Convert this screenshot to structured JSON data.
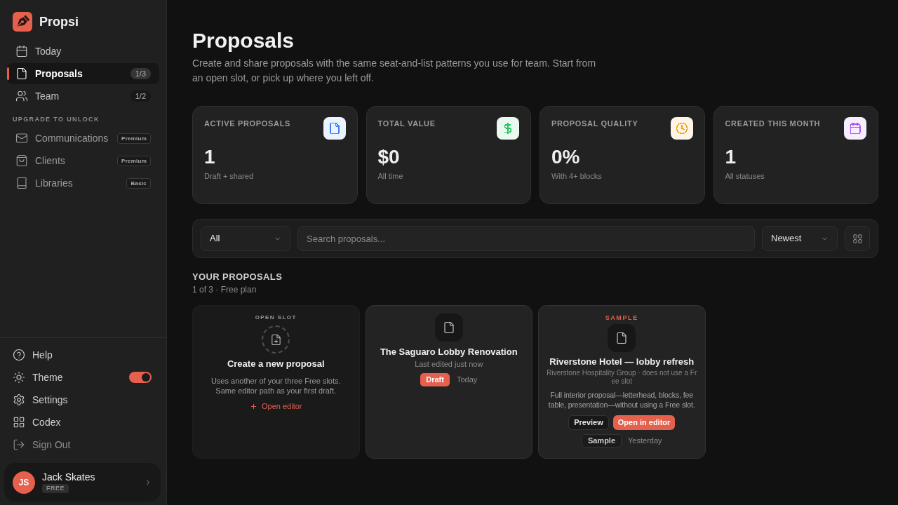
{
  "sidebar": {
    "brand": "Propsi",
    "nav": [
      {
        "label": "Today",
        "selected": false
      },
      {
        "label": "Proposals",
        "selected": true,
        "badge": "1/3"
      },
      {
        "label": "Team",
        "selected": false,
        "badge": "1/2"
      }
    ],
    "upgrade_heading": "UPGRADE TO UNLOCK",
    "locked_items": [
      {
        "label": "Communications",
        "badge": "Premium"
      },
      {
        "label": "Clients",
        "badge": "Premium"
      },
      {
        "label": "Libraries",
        "badge": "Basic"
      }
    ],
    "footer_items": [
      {
        "label": "Help",
        "kind": "link"
      },
      {
        "label": "Theme",
        "kind": "toggle",
        "on": true
      },
      {
        "label": "Settings",
        "kind": "link"
      },
      {
        "label": "Codex",
        "kind": "link"
      },
      {
        "label": "Sign Out",
        "kind": "exit"
      }
    ],
    "user": {
      "initials": "JS",
      "name": "Jack Skates",
      "plan": "FREE"
    }
  },
  "header": {
    "title": "Proposals",
    "description": "Create and share proposals with the same seat-and-list patterns you use for team. Start from an open slot, or pick up where you left off."
  },
  "stats": [
    {
      "label": "ACTIVE PROPOSALS",
      "value": "1",
      "caption": "Draft + shared",
      "color": "#3b82f6"
    },
    {
      "label": "TOTAL VALUE",
      "value": "$0",
      "caption": "All time",
      "color": "#22c55e"
    },
    {
      "label": "PROPOSAL QUALITY",
      "value": "0%",
      "caption": "With 4+ blocks",
      "color": "#f59e0b"
    },
    {
      "label": "CREATED THIS MONTH",
      "value": "1",
      "caption": "All statuses",
      "color": "#a855f7"
    }
  ],
  "filters": {
    "status": {
      "value": "All"
    },
    "search": {
      "placeholder": "Search proposals..."
    },
    "sort": {
      "value": "Newest"
    }
  },
  "proposals": {
    "heading": "YOUR PROPOSALS",
    "subheading": "1 of 3 · Free plan",
    "cards": [
      {
        "kind": "open_slot",
        "eyebrow": "OPEN SLOT",
        "title": "Create a new proposal",
        "description": "Uses another of your three Free slots. Same editor path as your first draft.",
        "action": "Open editor"
      },
      {
        "kind": "proposal",
        "title": "The Saguaro Lobby Renovation",
        "meta": "Last edited just now",
        "status": "Draft",
        "date": "Today"
      },
      {
        "kind": "sample",
        "eyebrow": "SAMPLE",
        "title": "Riverstone Hotel — lobby refresh",
        "meta": "Riverstone Hospitality Group · does not use a Free slot",
        "description": "Full interior proposal—letterhead, blocks, fee table, presentation—without using a Free slot.",
        "buttons": [
          "Preview",
          "Open in editor"
        ],
        "status": "Sample",
        "date": "Yesterday"
      }
    ]
  }
}
